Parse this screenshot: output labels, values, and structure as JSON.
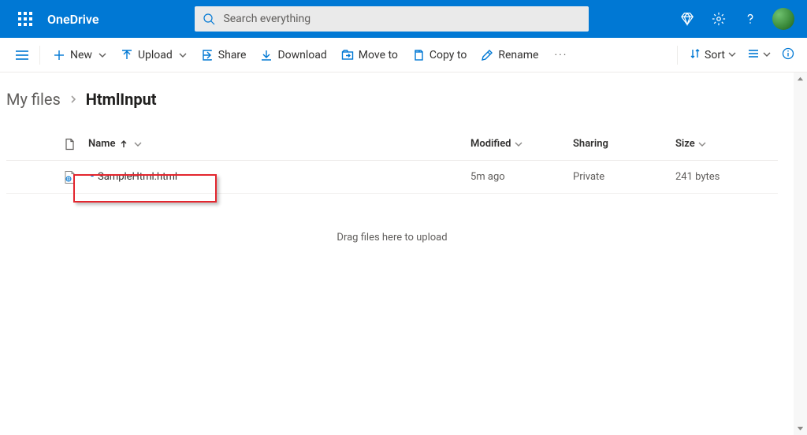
{
  "header": {
    "brand": "OneDrive",
    "search_placeholder": "Search everything"
  },
  "toolbar": {
    "new": "New",
    "upload": "Upload",
    "share": "Share",
    "download": "Download",
    "move_to": "Move to",
    "copy_to": "Copy to",
    "rename": "Rename",
    "sort": "Sort"
  },
  "breadcrumb": {
    "root": "My files",
    "current": "HtmlInput"
  },
  "columns": {
    "name": "Name",
    "modified": "Modified",
    "sharing": "Sharing",
    "size": "Size"
  },
  "files": [
    {
      "name": "SampleHtml.html",
      "modified": "5m ago",
      "sharing": "Private",
      "size": "241 bytes"
    }
  ],
  "drop_hint": "Drag files here to upload"
}
